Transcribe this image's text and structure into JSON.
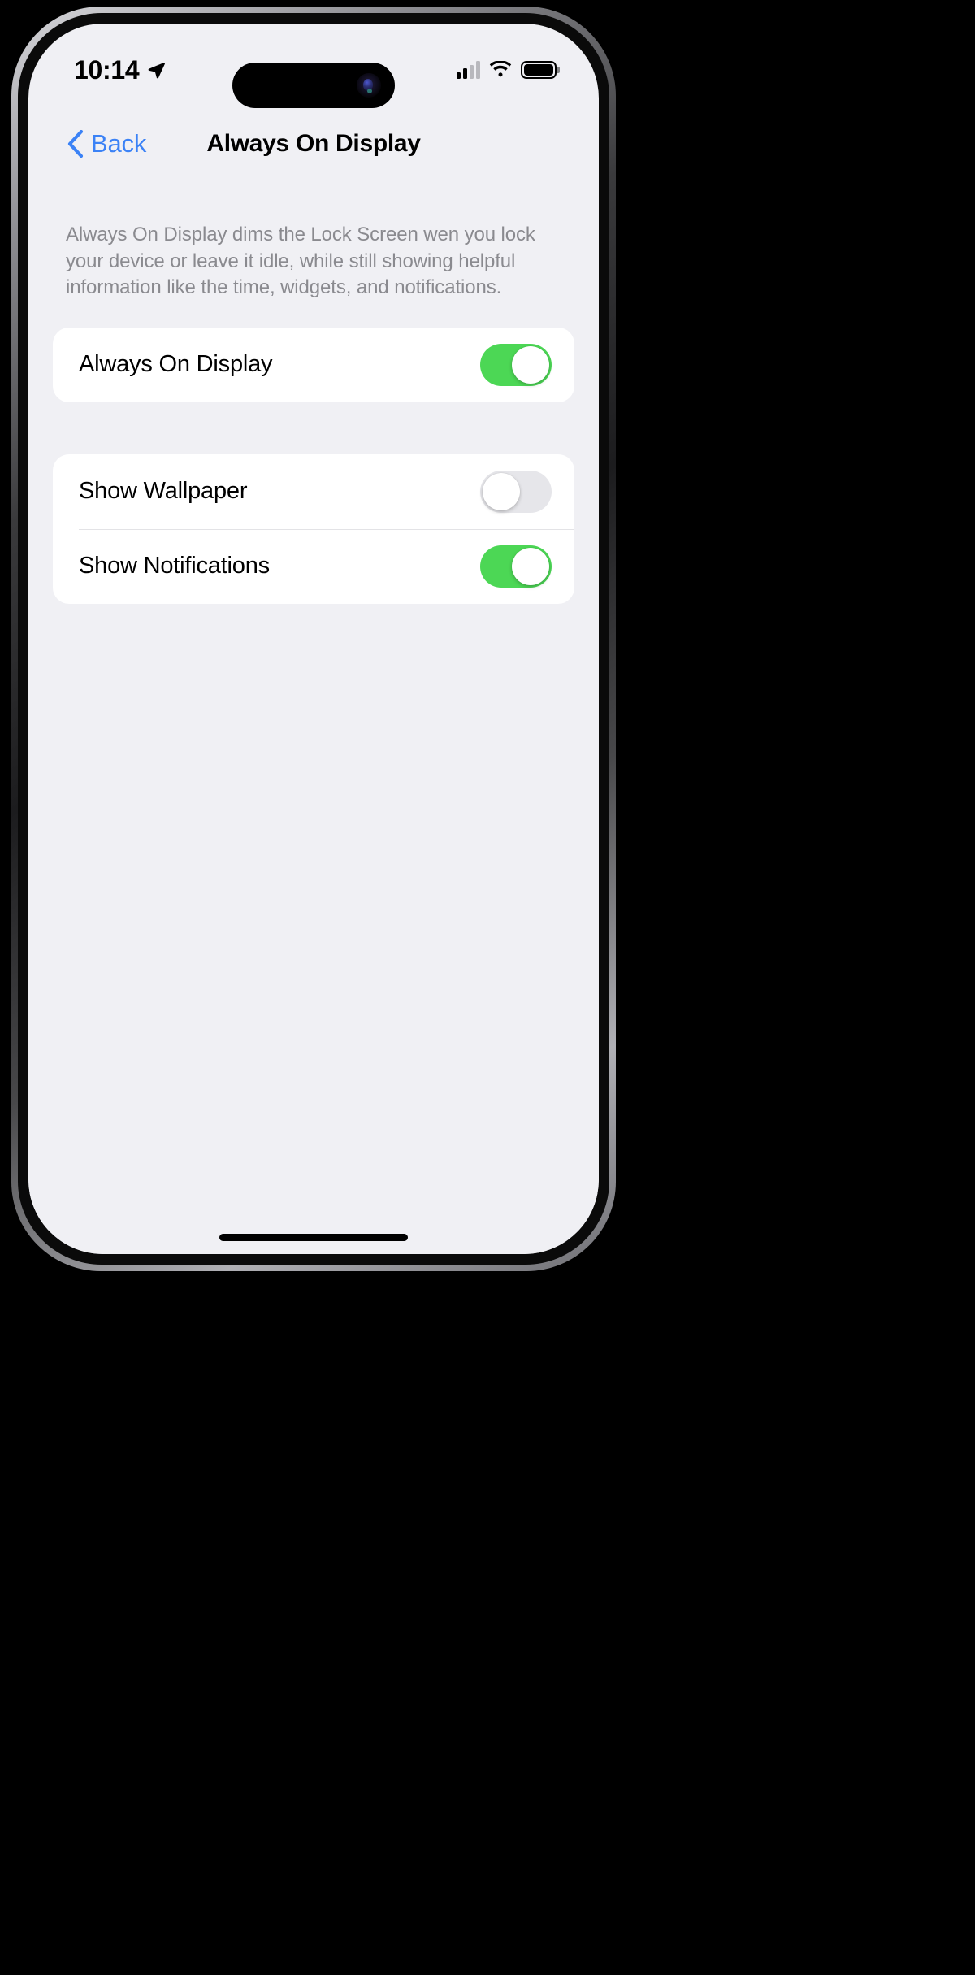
{
  "status_bar": {
    "time": "10:14",
    "location_icon": "location-arrow-icon",
    "cellular_icon": "cellular-signal-icon",
    "wifi_icon": "wifi-icon",
    "battery_icon": "battery-full-icon"
  },
  "nav": {
    "back_label": "Back",
    "back_icon": "chevron-left-icon",
    "title": "Always On Display"
  },
  "footer_text": "Always On Display dims the Lock Screen wen you lock your device or leave it idle, while still showing helpful information like the time, widgets, and notifications.",
  "groups": [
    {
      "rows": [
        {
          "label": "Always On Display",
          "toggle_state": "on"
        }
      ]
    },
    {
      "rows": [
        {
          "label": "Show Wallpaper",
          "toggle_state": "off"
        },
        {
          "label": "Show Notifications",
          "toggle_state": "on"
        }
      ]
    }
  ],
  "colors": {
    "accent_blue": "#3b82f6",
    "toggle_on_green": "#4cd755",
    "toggle_off_gray": "#e6e6ea",
    "background": "#f0f0f4",
    "card": "#ffffff",
    "footer_text": "#8a8a8f"
  }
}
